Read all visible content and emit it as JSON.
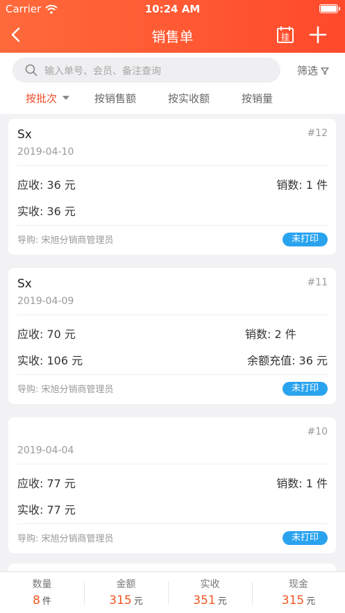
{
  "status": {
    "carrier": "Carrier",
    "time": "10:24 AM"
  },
  "nav": {
    "title": "销售单",
    "calendar_char": "挂"
  },
  "search": {
    "placeholder": "输入单号、会员、备注查询"
  },
  "filter": {
    "label": "筛选"
  },
  "tabs": [
    {
      "label": "按批次"
    },
    {
      "label": "按销售额"
    },
    {
      "label": "按实收额"
    },
    {
      "label": "按销量"
    }
  ],
  "orders": [
    {
      "name": "Sx",
      "num": "#12",
      "date": "2019-04-10",
      "receivable": "应收: 36 元",
      "sales": "销数: 1 件",
      "actual": "实收: 36 元",
      "extra": "",
      "guide": "导购:  宋旭分销商管理员",
      "status": "未打印"
    },
    {
      "name": "Sx",
      "num": "#11",
      "date": "2019-04-09",
      "receivable": "应收: 70 元",
      "sales": "销数: 2 件",
      "actual": "实收: 106 元",
      "extra": "余额充值: 36 元",
      "guide": "导购:  宋旭分销商管理员",
      "status": "未打印"
    },
    {
      "name": "",
      "num": "#10",
      "date": "2019-04-04",
      "receivable": "应收: 77 元",
      "sales": "销数: 1 件",
      "actual": "实收: 77 元",
      "extra": "",
      "guide": "导购:  宋旭分销商管理员",
      "status": "未打印"
    }
  ],
  "footer": [
    {
      "label": "数量",
      "value": "8",
      "unit": "件"
    },
    {
      "label": "金额",
      "value": "315",
      "unit": "元"
    },
    {
      "label": "实收",
      "value": "351",
      "unit": "元"
    },
    {
      "label": "现金",
      "value": "315",
      "unit": "元"
    }
  ],
  "colors": {
    "accent": "#f04a28",
    "badge": "#2aa3ef",
    "header": "#ff5a33"
  }
}
